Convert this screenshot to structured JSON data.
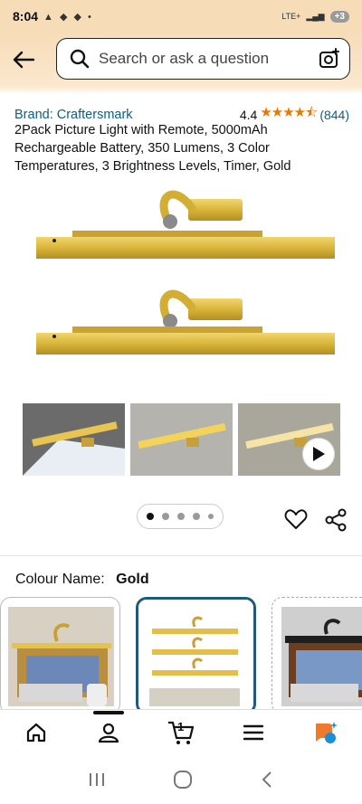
{
  "status_bar": {
    "time": "8:04",
    "network": "LTE+",
    "battery_badge": "+3"
  },
  "search": {
    "placeholder": "Search or ask a question"
  },
  "product": {
    "brand_label": "Brand: Craftersmark",
    "rating_value": "4.4",
    "stars_glyphs": "★★★★⯪",
    "review_count": "(844)",
    "title": "2Pack Picture Light with Remote, 5000mAh Rechargeable Battery, 350 Lumens, 3 Color Temperatures, 3 Brightness Levels, Timer, Gold"
  },
  "gallery": {
    "page_count": 5,
    "active_page": 1
  },
  "colour": {
    "label": "Colour Name:",
    "value": "Gold"
  },
  "bottom_nav": {
    "cart_count": "1"
  },
  "colors": {
    "accent": "#e67a00",
    "link": "#0f5c84",
    "header_bg": "#f7dcb8",
    "gold": "#d9b53a"
  },
  "icons": [
    "back-arrow-icon",
    "search-icon",
    "camera-lens-icon",
    "heart-icon",
    "share-icon",
    "play-icon",
    "home-icon",
    "profile-icon",
    "cart-icon",
    "menu-icon",
    "rufus-ai-icon"
  ]
}
